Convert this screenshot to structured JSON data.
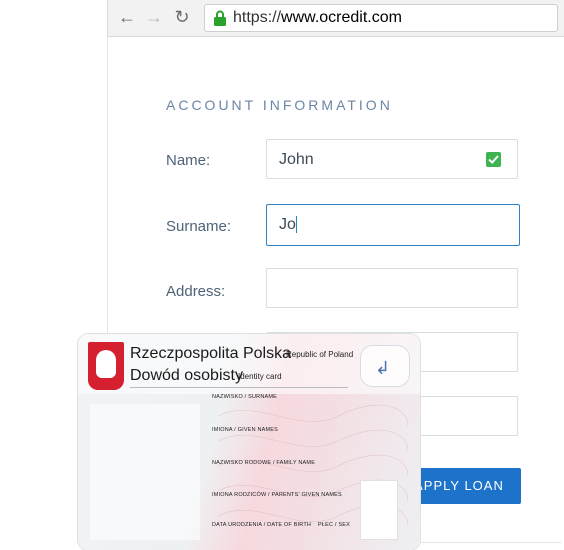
{
  "browser": {
    "url_scheme": "https://",
    "url_host": "www.ocredit.com"
  },
  "form": {
    "section_title": "ACCOUNT INFORMATION",
    "name_label": "Name:",
    "name_value": "John",
    "surname_label": "Surname:",
    "surname_value": "Jo",
    "address_label": "Address:",
    "address_value": "",
    "apply_button": "APPLY LOAN"
  },
  "id_card": {
    "title_pl": "Rzeczpospolita Polska",
    "title_en": "Republic of Poland",
    "doc_pl": "Dowód osobisty",
    "doc_en": "Identity card",
    "fields": [
      "NAZWISKO / SURNAME",
      "IMIONA / GIVEN NAMES",
      "NAZWISKO RODOWE / FAMILY NAME",
      "IMIONA RODZICÓW / PARENTS' GIVEN NAMES",
      "DATA URODZENIA / DATE OF BIRTH",
      "PŁEC / SEX"
    ]
  },
  "colors": {
    "accent": "#1d73c9",
    "focus_border": "#2e82c4",
    "valid_check": "#3fb34f",
    "emblem_red": "#d4202f"
  }
}
